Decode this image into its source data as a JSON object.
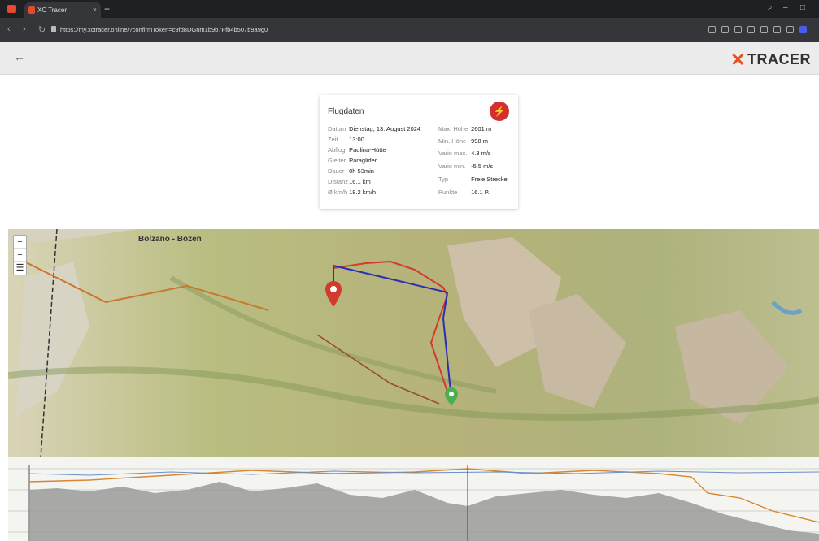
{
  "browser": {
    "tab_title": "XC Tracer",
    "url": "https://my.xctracer.online/?confirmToken=c9fd8DGnm1b9b7Ffb4b507b9a9g0"
  },
  "header": {
    "back_icon": "arrow-left-icon",
    "brand": "TRACER",
    "brand_accent": "#e8501f"
  },
  "flight_card": {
    "title": "Flugdaten",
    "action_icon": "lightning-bolt-icon",
    "left": [
      {
        "label": "Datum",
        "value": "Dienstag, 13. August 2024"
      },
      {
        "label": "Zeit",
        "value": "13:00"
      },
      {
        "label": "Abflug",
        "value": "Paolina-Hütte"
      },
      {
        "label": "Gleiter",
        "value": "Paraglider"
      },
      {
        "label": "Dauer",
        "value": "0h 53min"
      },
      {
        "label": "Distanz",
        "value": "16.1 km"
      },
      {
        "label": "Ø km/h",
        "value": "18.2 km/h"
      }
    ],
    "right": [
      {
        "label": "Max. Höhe",
        "value": "2601 m"
      },
      {
        "label": "Min. Höhe",
        "value": "998 m"
      },
      {
        "label": "Vario max.",
        "value": "4.3 m/s"
      },
      {
        "label": "Vario min.",
        "value": "-5.5 m/s"
      },
      {
        "label": "Typ",
        "value": "Freie Strecke"
      },
      {
        "label": "Punkte",
        "value": "16.1 P."
      }
    ]
  },
  "map": {
    "city_label": "Bolzano - Bozen",
    "zoom_in": "+",
    "zoom_out": "−",
    "track_color": "#d33a2c",
    "route_color": "#2b2fb0"
  }
}
